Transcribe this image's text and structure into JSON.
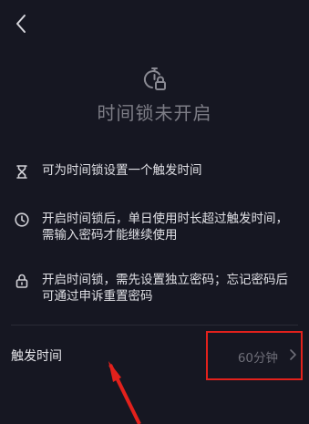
{
  "header": {
    "back_icon": "chevron-left-icon"
  },
  "hero": {
    "icon": "timer-lock-icon",
    "title": "时间锁未开启"
  },
  "features": [
    {
      "icon": "hourglass-icon",
      "text": "可为时间锁设置一个触发时间"
    },
    {
      "icon": "clock-icon",
      "text": "开启时间锁后，单日使用时长超过触发时间，需输入密码才能继续使用"
    },
    {
      "icon": "lock-icon",
      "text": "开启时间锁，需先设置独立密码；忘记密码后可通过申诉重置密码"
    }
  ],
  "trigger_row": {
    "label": "触发时间",
    "value": "60分钟",
    "chevron_icon": "chevron-right-icon"
  },
  "annotation": {
    "color": "#e2211c"
  },
  "colors": {
    "background": "#161722",
    "muted_text": "#7d7d86",
    "text": "#e0e0e5"
  }
}
